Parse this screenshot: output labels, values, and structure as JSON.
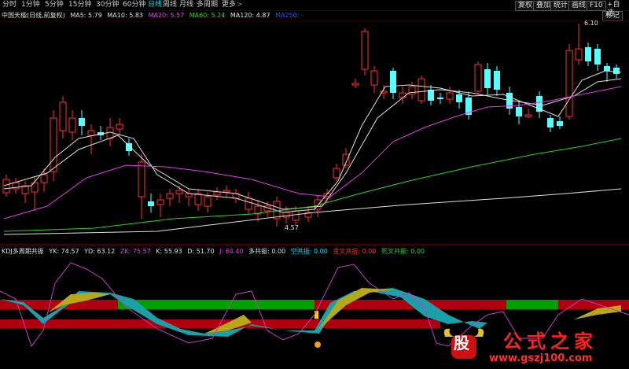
{
  "toolbar": {
    "tabs": [
      {
        "label": "分时",
        "active": false
      },
      {
        "label": "1分钟",
        "active": false
      },
      {
        "label": "5分钟",
        "active": false
      },
      {
        "label": "15分钟",
        "active": false
      },
      {
        "label": "30分钟",
        "active": false
      },
      {
        "label": "60分钟",
        "active": false
      },
      {
        "label": "日线",
        "active": true
      },
      {
        "label": "周线",
        "active": false
      },
      {
        "label": "月线",
        "active": false
      },
      {
        "label": "多周期",
        "active": false
      },
      {
        "label": "更多",
        "active": false
      }
    ],
    "right_buttons": [
      "复权",
      "叠加",
      "统计",
      "画线",
      "F10",
      "标记",
      "+自选"
    ]
  },
  "price_legend": {
    "stock": "中国天楹(日线,前复权)",
    "items": [
      {
        "label": "MA5: 5.79",
        "color": "#e0e0e0"
      },
      {
        "label": "MA10: 5.83",
        "color": "#e0e0e0"
      },
      {
        "label": "MA20: 5.57",
        "color": "#e040e0"
      },
      {
        "label": "MA60: 5.24",
        "color": "#30d030"
      },
      {
        "label": "MA120: 4.87",
        "color": "#e0e0e0"
      },
      {
        "label": "MA250: -",
        "color": "#3050ff"
      }
    ]
  },
  "annotations": {
    "high": "6.10",
    "low": "4.57"
  },
  "kdj_legend": {
    "items": [
      {
        "label": "KDJ多周期共振",
        "color": "#e0e0e0"
      },
      {
        "label": "YK: 74.57",
        "color": "#e0e0e0"
      },
      {
        "label": "YD: 63.12",
        "color": "#e0e0e0"
      },
      {
        "label": "ZK: 75.57",
        "color": "#e040e0"
      },
      {
        "label": "K: 55.93",
        "color": "#e0e0e0"
      },
      {
        "label": "D: 51.70",
        "color": "#e0e0e0"
      },
      {
        "label": "J: 64.40",
        "color": "#e040e0"
      },
      {
        "label": "多共振: 0.00",
        "color": "#e0e0e0"
      },
      {
        "label": "空共振: 0.00",
        "color": "#00e5ff"
      },
      {
        "label": "金叉共振: 0.00",
        "color": "#ff3030"
      },
      {
        "label": "死叉共振: 0.00",
        "color": "#30d030"
      }
    ]
  },
  "watermark": {
    "brand": "公式之家",
    "logo_char": "股",
    "url": "www.gszj100.com"
  },
  "colors": {
    "up": "#ff3030",
    "down": "#54ffff",
    "band_red": "#b00010",
    "band_green": "#00a000",
    "teal": "#1aa0a8",
    "olive": "#b8a818"
  }
}
